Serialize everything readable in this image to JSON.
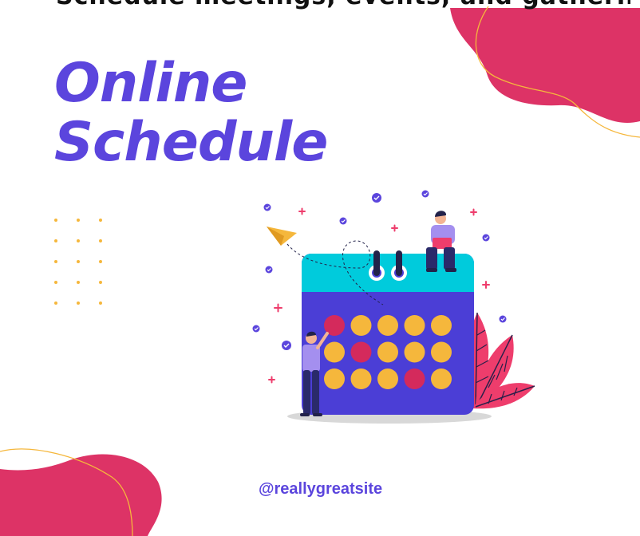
{
  "header": {
    "partial_text": "Schedule meetings, events, and gatherings in one"
  },
  "hero": {
    "title_line1": "Online",
    "title_line2": "Schedule"
  },
  "footer": {
    "handle": "@reallygreatsite"
  },
  "calendar": {
    "dot_colors": [
      [
        "#d42a5c",
        "#f5b73c",
        "#f5b73c",
        "#f5b73c",
        "#f5b73c"
      ],
      [
        "#f5b73c",
        "#d42a5c",
        "#f5b73c",
        "#f5b73c",
        "#f5b73c"
      ],
      [
        "#f5b73c",
        "#f5b73c",
        "#f5b73c",
        "#d42a5c",
        "#f5b73c"
      ]
    ]
  },
  "colors": {
    "brand_purple": "#5b45dd",
    "blob_pink": "#dd3366",
    "accent_yellow": "#f5b73c",
    "calendar_top": "#00cbdc",
    "calendar_body": "#4b3ed6"
  },
  "icons": [
    "paper-plane-icon",
    "check-circle-icon",
    "plus-icon",
    "leaf-icon"
  ]
}
